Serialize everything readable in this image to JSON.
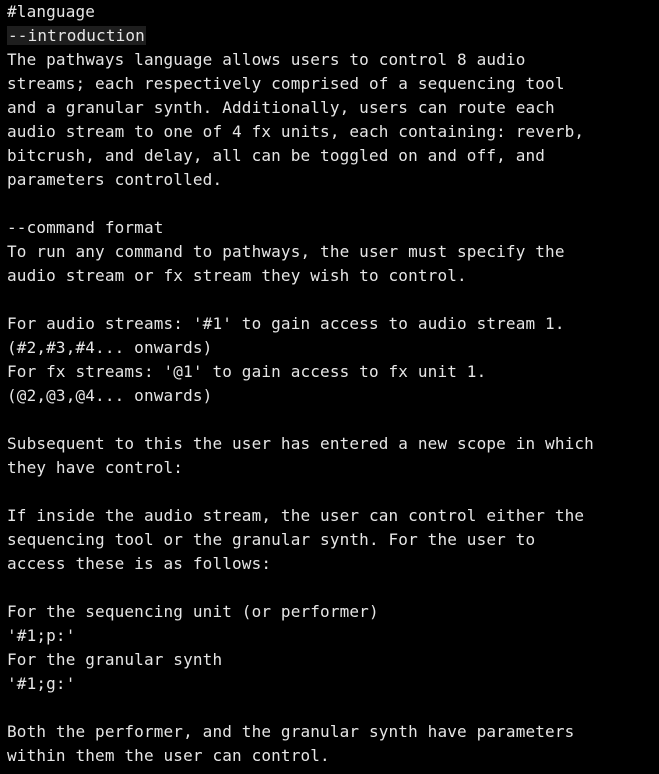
{
  "document": {
    "lines": [
      "#language",
      "--introduction",
      "The pathways language allows users to control 8 audio",
      "streams; each respectively comprised of a sequencing tool",
      "and a granular synth. Additionally, users can route each",
      "audio stream to one of 4 fx units, each containing: reverb,",
      "bitcrush, and delay, all can be toggled on and off, and",
      "parameters controlled.",
      "",
      "--command format",
      "To run any command to pathways, the user must specify the",
      "audio stream or fx stream they wish to control.",
      "",
      "For audio streams: '#1' to gain access to audio stream 1.",
      "(#2,#3,#4... onwards)",
      "For fx streams: '@1' to gain access to fx unit 1.",
      "(@2,@3,@4... onwards)",
      "",
      "Subsequent to this the user has entered a new scope in which",
      "they have control:",
      "",
      "If inside the audio stream, the user can control either the",
      "sequencing tool or the granular synth. For the user to",
      "access these is as follows:",
      "",
      "For the sequencing unit (or performer)",
      "'#1;p:'",
      "For the granular synth",
      "'#1;g:'",
      "",
      "Both the performer, and the granular synth have parameters",
      "within them the user can control."
    ]
  },
  "colors": {
    "background": "#000000",
    "text": "#e6e6e6",
    "highlight": "#1e1e1e"
  }
}
